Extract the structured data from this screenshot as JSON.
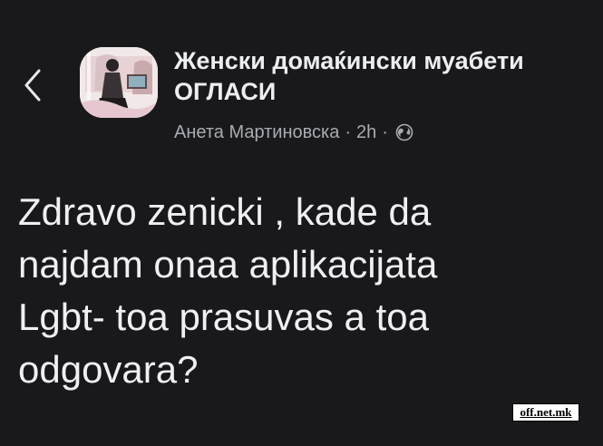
{
  "header": {
    "back_icon": "chevron-left-icon",
    "group_title_line1": "Женски домаќински муабети",
    "group_title_line2": "ОГЛАСИ",
    "author": "Анета Мартиновска",
    "separator": "·",
    "time": "2h",
    "privacy_icon": "globe-icon"
  },
  "post": {
    "lines": [
      "Zdravo zenicki , kade da",
      "najdam onaa aplikacijata",
      "Lgbt- toa prasuvas a toa",
      "odgovara?"
    ]
  },
  "watermark": {
    "text": "off.net.mk"
  },
  "colors": {
    "background": "#19191b",
    "text_primary": "#eceef1",
    "text_secondary": "#a8abb1"
  }
}
